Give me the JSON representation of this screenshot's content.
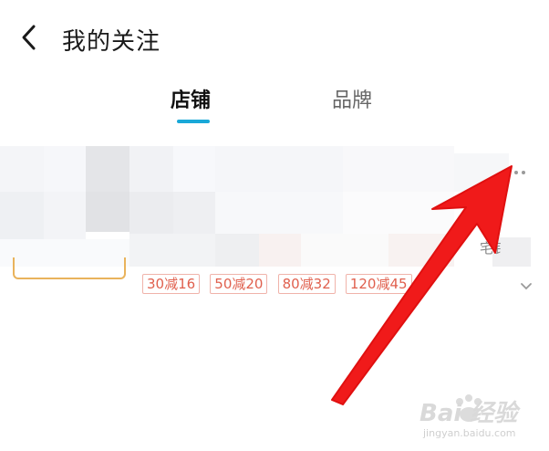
{
  "header": {
    "back_icon": "chevron-left-icon",
    "title": "我的关注"
  },
  "tabs": [
    {
      "label": "店铺",
      "active": true
    },
    {
      "label": "品牌",
      "active": false
    }
  ],
  "colors": {
    "tab_indicator": "#19a8d8",
    "coupon_border": "#f0b3aa",
    "coupon_text": "#e0604e",
    "arrow": "#f01a1a"
  },
  "store_card": {
    "more_icon": "more-dots-icon",
    "partial_right_text": "宅钅",
    "coupons": [
      "30减16",
      "50减20",
      "80减32",
      "120减45"
    ],
    "expand_icon": "chevron-down-icon"
  },
  "watermark": {
    "main": "Bai 经验",
    "sub": "jingyan.baidu.com"
  }
}
